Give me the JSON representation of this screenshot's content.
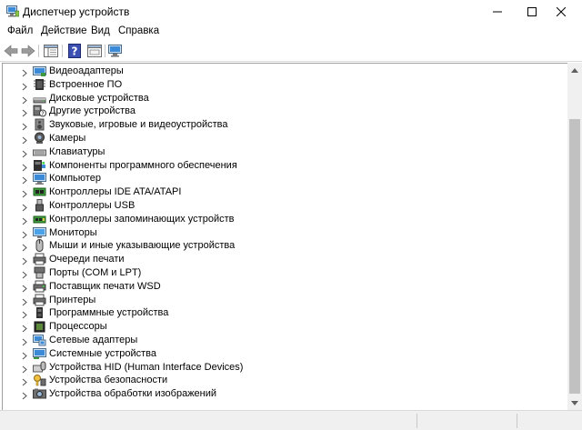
{
  "window": {
    "title": "Диспетчер устройств"
  },
  "menu": [
    {
      "label": "Файл"
    },
    {
      "label": "Действие"
    },
    {
      "label": "Вид"
    },
    {
      "label": "Справка"
    }
  ],
  "toolbar": {
    "buttons": [
      "back-icon",
      "forward-icon",
      "show-hide-tree-icon",
      "help-icon",
      "scan-hardware-icon"
    ]
  },
  "devices": [
    {
      "label": "Видеоадаптеры",
      "icon": "display-adapter-icon"
    },
    {
      "label": "Встроенное ПО",
      "icon": "firmware-icon"
    },
    {
      "label": "Дисковые устройства",
      "icon": "disk-drive-icon"
    },
    {
      "label": "Другие устройства",
      "icon": "unknown-device-icon"
    },
    {
      "label": "Звуковые, игровые и видеоустройства",
      "icon": "speaker-icon"
    },
    {
      "label": "Камеры",
      "icon": "camera-icon"
    },
    {
      "label": "Клавиатуры",
      "icon": "keyboard-icon"
    },
    {
      "label": "Компоненты программного обеспечения",
      "icon": "software-component-icon"
    },
    {
      "label": "Компьютер",
      "icon": "computer-icon"
    },
    {
      "label": "Контроллеры IDE ATA/ATAPI",
      "icon": "ide-controller-icon"
    },
    {
      "label": "Контроллеры USB",
      "icon": "usb-icon"
    },
    {
      "label": "Контроллеры запоминающих устройств",
      "icon": "storage-controller-icon"
    },
    {
      "label": "Мониторы",
      "icon": "monitor-icon"
    },
    {
      "label": "Мыши и иные указывающие устройства",
      "icon": "mouse-icon"
    },
    {
      "label": "Очереди печати",
      "icon": "print-queue-icon"
    },
    {
      "label": "Порты (COM и LPT)",
      "icon": "port-icon"
    },
    {
      "label": "Поставщик печати WSD",
      "icon": "wsd-printer-icon"
    },
    {
      "label": "Принтеры",
      "icon": "printer-icon"
    },
    {
      "label": "Программные устройства",
      "icon": "software-device-icon"
    },
    {
      "label": "Процессоры",
      "icon": "processor-icon"
    },
    {
      "label": "Сетевые адаптеры",
      "icon": "network-adapter-icon"
    },
    {
      "label": "Системные устройства",
      "icon": "system-device-icon"
    },
    {
      "label": "Устройства HID (Human Interface Devices)",
      "icon": "hid-icon"
    },
    {
      "label": "Устройства безопасности",
      "icon": "security-device-icon"
    },
    {
      "label": "Устройства обработки изображений",
      "icon": "imaging-device-icon"
    }
  ]
}
